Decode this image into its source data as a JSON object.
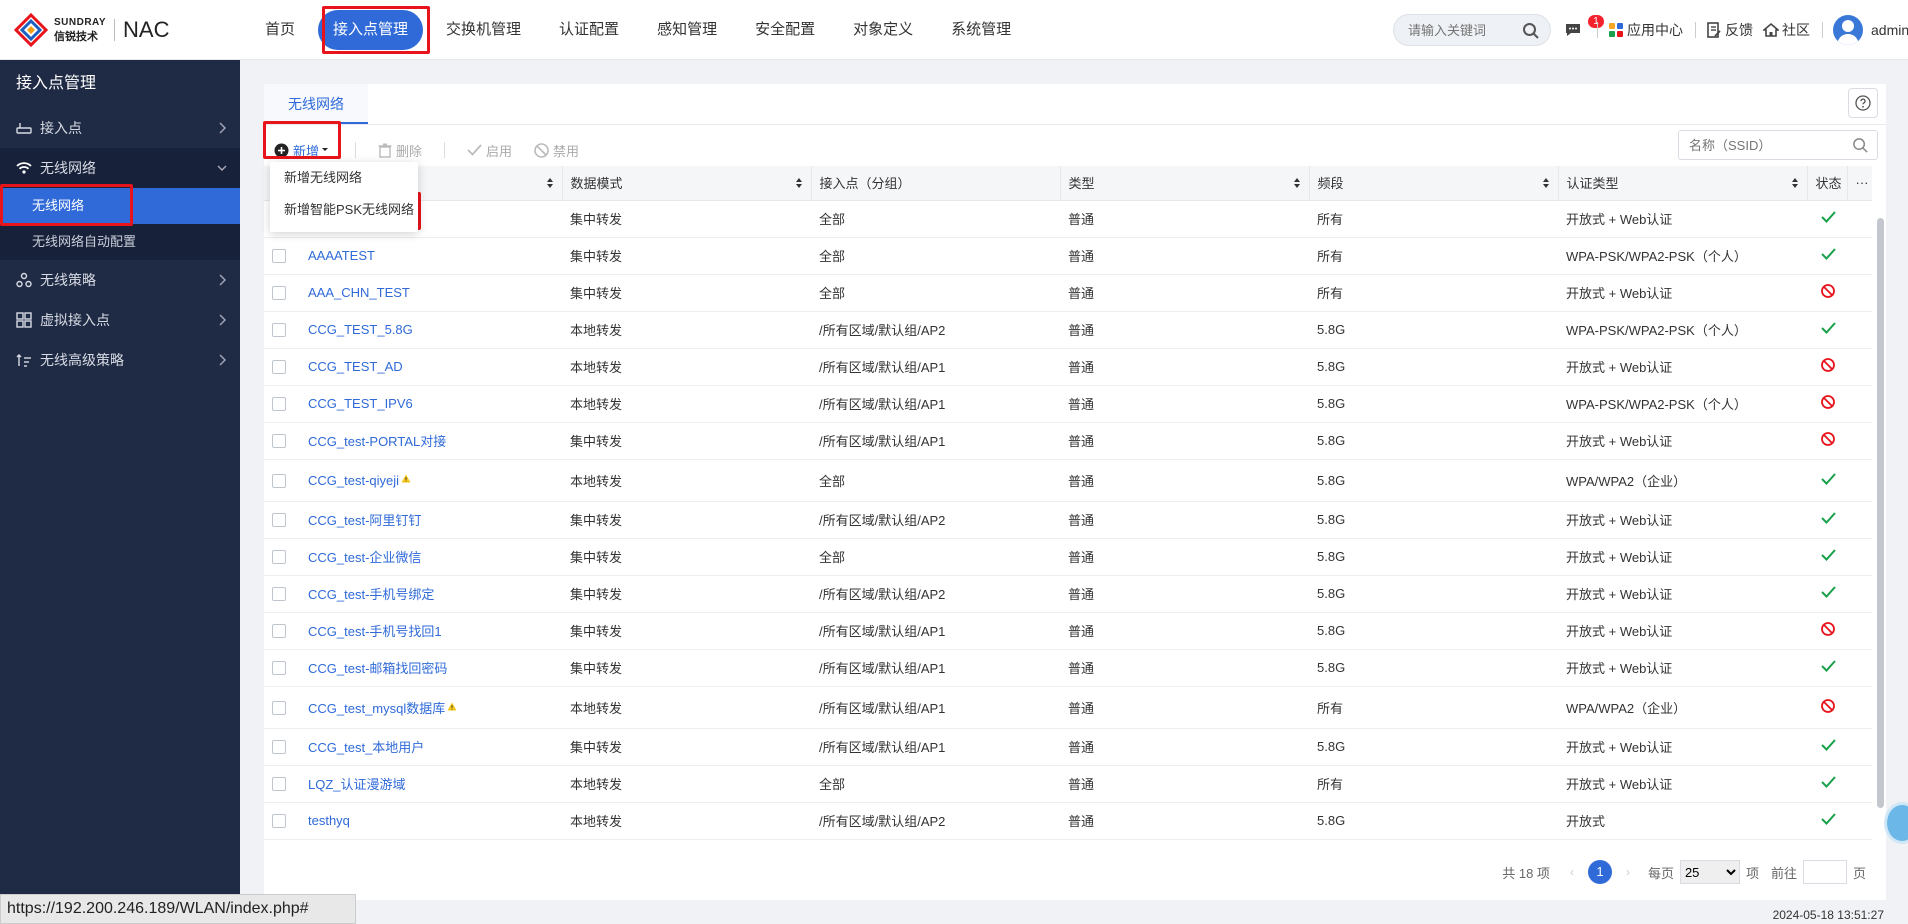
{
  "brand": {
    "name_en": "SUNDRAY",
    "name_cn": "信锐技术",
    "product": "NAC"
  },
  "nav": [
    {
      "label": "首页"
    },
    {
      "label": "接入点管理"
    },
    {
      "label": "交换机管理"
    },
    {
      "label": "认证配置"
    },
    {
      "label": "感知管理"
    },
    {
      "label": "安全配置"
    },
    {
      "label": "对象定义"
    },
    {
      "label": "系统管理"
    }
  ],
  "top_search": {
    "placeholder": "请输入关键词"
  },
  "top_right": {
    "badge": "1",
    "app_center": "应用中心",
    "feedback": "反馈",
    "community": "社区",
    "user": "admin"
  },
  "sidebar": {
    "title": "接入点管理",
    "items": [
      {
        "label": "接入点"
      },
      {
        "label": "无线网络"
      },
      {
        "label": "无线策略"
      },
      {
        "label": "虚拟接入点"
      },
      {
        "label": "无线高级策略"
      }
    ],
    "subitems": [
      {
        "label": "无线网络"
      },
      {
        "label": "无线网络自动配置"
      }
    ]
  },
  "tab": {
    "label": "无线网络"
  },
  "toolbar": {
    "add": "新增",
    "delete": "删除",
    "enable": "启用",
    "disable": "禁用"
  },
  "ssid_search": {
    "placeholder": "名称（SSID）"
  },
  "dropdown": {
    "item1": "新增无线网络",
    "item2": "新增智能PSK无线网络"
  },
  "table": {
    "headers": {
      "mode": "数据模式",
      "ap": "接入点（分组）",
      "type": "类型",
      "band": "频段",
      "auth": "认证类型",
      "status": "状态",
      "more": "···"
    },
    "rows": [
      {
        "name": "",
        "mode": "集中转发",
        "ap": "全部",
        "type": "普通",
        "band": "所有",
        "auth": "开放式 + Web认证",
        "ok": true
      },
      {
        "name": "AAAATEST",
        "mode": "集中转发",
        "ap": "全部",
        "type": "普通",
        "band": "所有",
        "auth": "WPA-PSK/WPA2-PSK（个人）",
        "ok": true
      },
      {
        "name": "AAA_CHN_TEST",
        "mode": "集中转发",
        "ap": "全部",
        "type": "普通",
        "band": "所有",
        "auth": "开放式 + Web认证",
        "ok": false
      },
      {
        "name": "CCG_TEST_5.8G",
        "mode": "本地转发",
        "ap": "/所有区域/默认组/AP2",
        "type": "普通",
        "band": "5.8G",
        "auth": "WPA-PSK/WPA2-PSK（个人）",
        "ok": true
      },
      {
        "name": "CCG_TEST_AD",
        "mode": "本地转发",
        "ap": "/所有区域/默认组/AP1",
        "type": "普通",
        "band": "5.8G",
        "auth": "开放式 + Web认证",
        "ok": false
      },
      {
        "name": "CCG_TEST_IPV6",
        "mode": "本地转发",
        "ap": "/所有区域/默认组/AP1",
        "type": "普通",
        "band": "5.8G",
        "auth": "WPA-PSK/WPA2-PSK（个人）",
        "ok": false
      },
      {
        "name": "CCG_test-PORTAL对接",
        "mode": "集中转发",
        "ap": "/所有区域/默认组/AP1",
        "type": "普通",
        "band": "5.8G",
        "auth": "开放式 + Web认证",
        "ok": false
      },
      {
        "name": "CCG_test-qiyeji",
        "mode": "本地转发",
        "ap": "全部",
        "type": "普通",
        "band": "5.8G",
        "auth": "WPA/WPA2（企业）",
        "ok": true,
        "warn": true
      },
      {
        "name": "CCG_test-阿里钉钉",
        "mode": "集中转发",
        "ap": "/所有区域/默认组/AP2",
        "type": "普通",
        "band": "5.8G",
        "auth": "开放式 + Web认证",
        "ok": true
      },
      {
        "name": "CCG_test-企业微信",
        "mode": "集中转发",
        "ap": "全部",
        "type": "普通",
        "band": "5.8G",
        "auth": "开放式 + Web认证",
        "ok": true
      },
      {
        "name": "CCG_test-手机号绑定",
        "mode": "集中转发",
        "ap": "/所有区域/默认组/AP2",
        "type": "普通",
        "band": "5.8G",
        "auth": "开放式 + Web认证",
        "ok": true
      },
      {
        "name": "CCG_test-手机号找回1",
        "mode": "集中转发",
        "ap": "/所有区域/默认组/AP1",
        "type": "普通",
        "band": "5.8G",
        "auth": "开放式 + Web认证",
        "ok": false
      },
      {
        "name": "CCG_test-邮箱找回密码",
        "mode": "集中转发",
        "ap": "/所有区域/默认组/AP1",
        "type": "普通",
        "band": "5.8G",
        "auth": "开放式 + Web认证",
        "ok": true
      },
      {
        "name": "CCG_test_mysql数据库",
        "mode": "本地转发",
        "ap": "/所有区域/默认组/AP1",
        "type": "普通",
        "band": "所有",
        "auth": "WPA/WPA2（企业）",
        "ok": false,
        "warn": true
      },
      {
        "name": "CCG_test_本地用户",
        "mode": "集中转发",
        "ap": "/所有区域/默认组/AP1",
        "type": "普通",
        "band": "5.8G",
        "auth": "开放式 + Web认证",
        "ok": true
      },
      {
        "name": "LQZ_认证漫游域",
        "mode": "本地转发",
        "ap": "全部",
        "type": "普通",
        "band": "所有",
        "auth": "开放式 + Web认证",
        "ok": true
      },
      {
        "name": "testhyq",
        "mode": "本地转发",
        "ap": "/所有区域/默认组/AP2",
        "type": "普通",
        "band": "5.8G",
        "auth": "开放式",
        "ok": true
      }
    ]
  },
  "pager": {
    "total": "共 18 项",
    "page": "1",
    "per_page_label": "每页",
    "per_page": "25",
    "unit": "项",
    "goto": "前往",
    "page_unit": "页"
  },
  "status_url": "https://192.200.246.189/WLAN/index.php#",
  "clock": "2024-05-18 13:51:27",
  "colors": {
    "accent": "#2f6ad8",
    "ok": "#19a04b",
    "forbid": "#e8141b",
    "sidebar": "#1f2a44"
  }
}
